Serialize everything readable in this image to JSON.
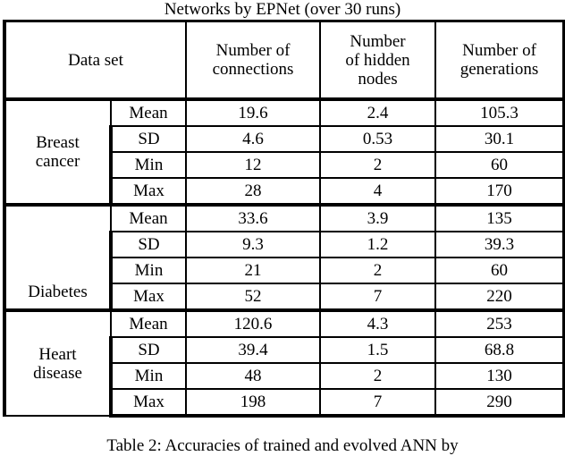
{
  "title": "Networks by EPNet (over 30 runs)",
  "caption": "Table 2: Accuracies of trained and evolved ANN by",
  "table": {
    "headers": {
      "data_set": "Data set",
      "connections": "Number of\nconnections",
      "connections_line1": "Number of",
      "connections_line2": "connections",
      "hidden_nodes_line1": "Number",
      "hidden_nodes_line2": "of hidden",
      "hidden_nodes_line3": "nodes",
      "generations_line1": "Number of",
      "generations_line2": "generations"
    },
    "groups": [
      {
        "name_line1": "Breast",
        "name_line2": "cancer",
        "name_align": "middle",
        "rows": [
          {
            "stat": "Mean",
            "connections": "19.6",
            "hidden_nodes": "2.4",
            "generations": "105.3"
          },
          {
            "stat": "SD",
            "connections": "4.6",
            "hidden_nodes": "0.53",
            "generations": "30.1"
          },
          {
            "stat": "Min",
            "connections": "12",
            "hidden_nodes": "2",
            "generations": "60"
          },
          {
            "stat": "Max",
            "connections": "28",
            "hidden_nodes": "4",
            "generations": "170"
          }
        ]
      },
      {
        "name_line1": "Diabetes",
        "name_line2": "",
        "name_align": "bottom",
        "rows": [
          {
            "stat": "Mean",
            "connections": "33.6",
            "hidden_nodes": "3.9",
            "generations": "135"
          },
          {
            "stat": "SD",
            "connections": "9.3",
            "hidden_nodes": "1.2",
            "generations": "39.3"
          },
          {
            "stat": "Min",
            "connections": "21",
            "hidden_nodes": "2",
            "generations": "60"
          },
          {
            "stat": "Max",
            "connections": "52",
            "hidden_nodes": "7",
            "generations": "220"
          }
        ]
      },
      {
        "name_line1": "Heart",
        "name_line2": "disease",
        "name_align": "middle",
        "rows": [
          {
            "stat": "Mean",
            "connections": "120.6",
            "hidden_nodes": "4.3",
            "generations": "253"
          },
          {
            "stat": "SD",
            "connections": "39.4",
            "hidden_nodes": "1.5",
            "generations": "68.8"
          },
          {
            "stat": "Min",
            "connections": "48",
            "hidden_nodes": "2",
            "generations": "130"
          },
          {
            "stat": "Max",
            "connections": "198",
            "hidden_nodes": "7",
            "generations": "290"
          }
        ]
      }
    ]
  }
}
